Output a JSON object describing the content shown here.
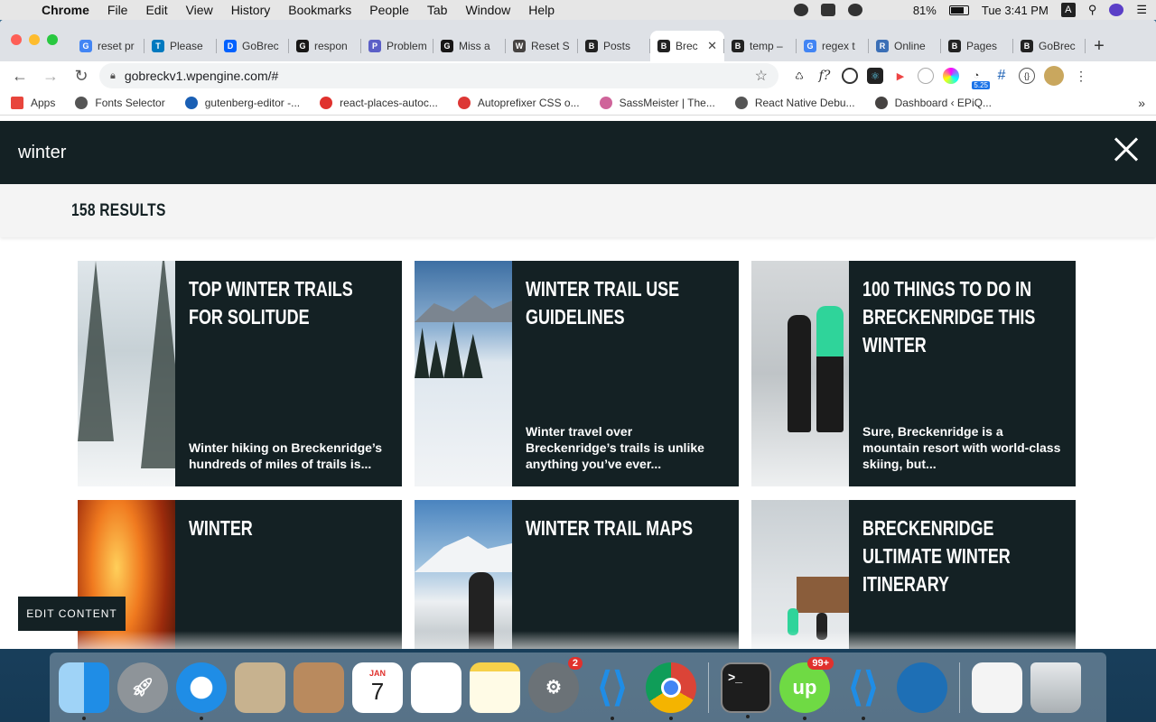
{
  "menubar": {
    "app_name": "Chrome",
    "menus": [
      "File",
      "Edit",
      "View",
      "History",
      "Bookmarks",
      "People",
      "Tab",
      "Window",
      "Help"
    ],
    "battery": "81%",
    "clock": "Tue 3:41 PM",
    "user_initial": "A"
  },
  "browser": {
    "tabs": [
      {
        "label": "reset pr",
        "icon": "google-icon",
        "color": "#4285f4",
        "glyph": "G"
      },
      {
        "label": "Please",
        "icon": "trello-icon",
        "color": "#0079bf",
        "glyph": "T"
      },
      {
        "label": "GoBrec",
        "icon": "dropbox-icon",
        "color": "#0061ff",
        "glyph": "D"
      },
      {
        "label": "respon",
        "icon": "github-icon",
        "color": "#181717",
        "glyph": "G"
      },
      {
        "label": "Problem",
        "icon": "chat-icon",
        "color": "#5b5fc7",
        "glyph": "P"
      },
      {
        "label": "Miss a",
        "icon": "github-icon",
        "color": "#181717",
        "glyph": "G"
      },
      {
        "label": "Reset S",
        "icon": "wordpress-icon",
        "color": "#464342",
        "glyph": "W"
      },
      {
        "label": "Posts",
        "icon": "b-icon",
        "color": "#222",
        "glyph": "B"
      },
      {
        "label": "Brec",
        "icon": "b-icon",
        "color": "#222",
        "glyph": "B",
        "active": true
      },
      {
        "label": "temp –",
        "icon": "b-icon",
        "color": "#222",
        "glyph": "B"
      },
      {
        "label": "regex t",
        "icon": "google-icon",
        "color": "#4285f4",
        "glyph": "G"
      },
      {
        "label": "Online",
        "icon": "r-icon",
        "color": "#3b6fb6",
        "glyph": "R"
      },
      {
        "label": "Pages",
        "icon": "b-icon",
        "color": "#222",
        "glyph": "B"
      },
      {
        "label": "GoBrec",
        "icon": "b-icon",
        "color": "#222",
        "glyph": "B"
      }
    ],
    "url": "gobreckv1.wpengine.com/#",
    "extension_badge": "5.25",
    "bookmarks": [
      {
        "label": "Apps",
        "icon": "apps-grid-icon"
      },
      {
        "label": "Fonts Selector",
        "icon": "globe-icon"
      },
      {
        "label": "gutenberg-editor -...",
        "icon": "bolt-icon"
      },
      {
        "label": "react-places-autoc...",
        "icon": "pin-icon"
      },
      {
        "label": "Autoprefixer CSS o...",
        "icon": "autoprefixer-icon"
      },
      {
        "label": "SassMeister | The...",
        "icon": "sass-icon"
      },
      {
        "label": "React Native Debu...",
        "icon": "globe-icon"
      },
      {
        "label": "Dashboard ‹ EPiQ...",
        "icon": "wordpress-icon"
      }
    ]
  },
  "search": {
    "query": "winter",
    "results_label": "158 RESULTS"
  },
  "results": [
    {
      "title": "TOP WINTER TRAILS FOR SOLITUDE",
      "excerpt": "Winter hiking on Breckenridge’s hundreds of miles of trails is...",
      "thumb": "snow-forest"
    },
    {
      "title": "WINTER TRAIL USE GUIDELINES",
      "excerpt": "Winter travel over Breckenridge’s trails is unlike anything you’ve ever...",
      "thumb": "snow-field"
    },
    {
      "title": "100 THINGS TO DO IN BRECKENRIDGE THIS WINTER",
      "excerpt": "Sure, Breckenridge is a mountain resort with world-class skiing, but...",
      "thumb": "skiers"
    },
    {
      "title": "WINTER",
      "excerpt": "",
      "thumb": "fire"
    },
    {
      "title": "WINTER TRAIL MAPS",
      "excerpt": "",
      "thumb": "mountain-hiker"
    },
    {
      "title": "BRECKENRIDGE ULTIMATE WINTER ITINERARY",
      "excerpt": "",
      "thumb": "resort"
    }
  ],
  "edit_content_label": "EDIT CONTENT",
  "dock": {
    "calendar_month": "JAN",
    "calendar_day": "7",
    "settings_badge": "2",
    "upwork_badge": "99+"
  }
}
